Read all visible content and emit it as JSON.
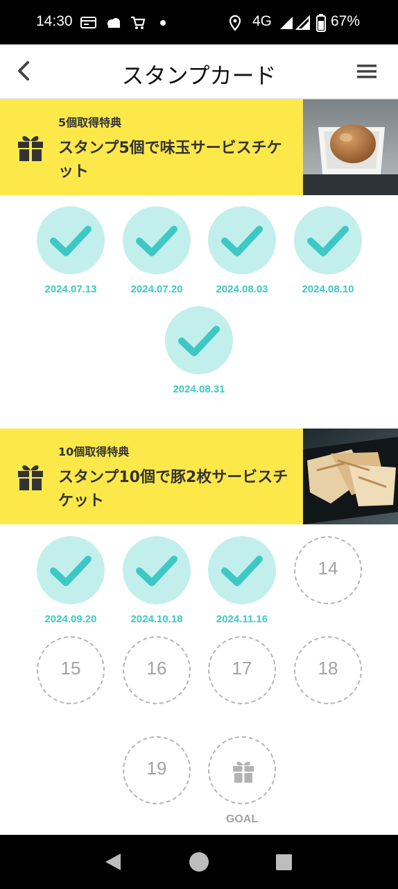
{
  "status_bar": {
    "time": "14:30",
    "network": "4G",
    "battery": "67%"
  },
  "header": {
    "title": "スタンプカード"
  },
  "rewards": [
    {
      "subtitle": "5個取得特典",
      "title": "スタンプ5個で味玉サービスチケット",
      "title_lines": [
        "スタンプ5個で味玉サービスチケ",
        "ット"
      ],
      "photo": "ajitama-egg-photo",
      "stamps": [
        {
          "date": "2024.07.13"
        },
        {
          "date": "2024.07.20"
        },
        {
          "date": "2024.08.03"
        },
        {
          "date": "2024.08.10"
        },
        {
          "date": "2024.08.31"
        }
      ]
    },
    {
      "subtitle": "10個取得特典",
      "title": "スタンプ10個で豚2枚サービスチケット",
      "title_lines": [
        "スタンプ10個で豚2枚サービスチ",
        "ケット"
      ],
      "photo": "chashu-pork-photo",
      "stamps": [
        {
          "date": "2024.09.20"
        },
        {
          "date": "2024.10.18"
        },
        {
          "date": "2024.11.16"
        }
      ],
      "empty_slots": [
        "14",
        "15",
        "16",
        "17",
        "18",
        "19"
      ],
      "goal_label": "GOAL"
    }
  ],
  "colors": {
    "banner": "#fde84a",
    "stamp_fill": "#c2efec",
    "check": "#3ec8c5",
    "date_text": "#3ec8c5",
    "empty_border": "#b5b5b5"
  },
  "icons": [
    "back-arrow-icon",
    "hamburger-menu-icon",
    "gift-icon",
    "checkmark-icon",
    "home-circle-icon",
    "back-triangle-icon",
    "recents-square-icon"
  ]
}
